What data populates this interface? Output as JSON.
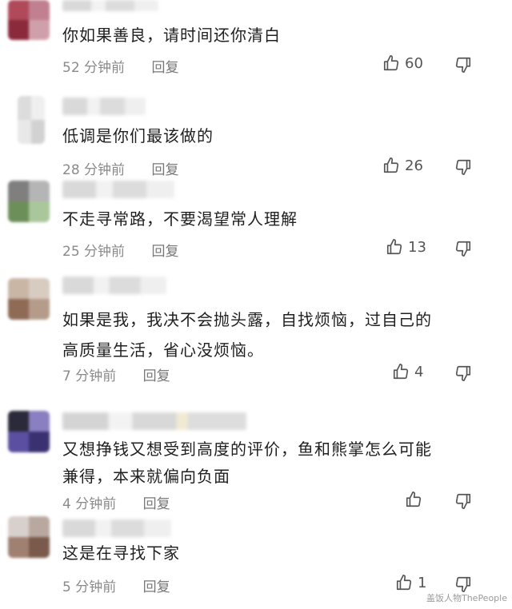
{
  "comments": [
    {
      "text": "你如果善良，请时间还你清白",
      "time": "52 分钟前",
      "reply": "回复",
      "likes": "60"
    },
    {
      "text": "低调是你们最该做的",
      "time": "28 分钟前",
      "reply": "回复",
      "likes": "26"
    },
    {
      "text": "不走寻常路，不要渴望常人理解",
      "time": "25 分钟前",
      "reply": "回复",
      "likes": "13"
    },
    {
      "text_line1": "如果是我，我决不会抛头露，自找烦恼，过自己的",
      "text_line2": "高质量生活，省心没烦恼。",
      "time": "7 分钟前",
      "reply": "回复",
      "likes": "4"
    },
    {
      "text_line1": "又想挣钱又想受到高度的评价，鱼和熊掌怎么可能",
      "text_line2": "兼得，本来就偏向负面",
      "time": "4 分钟前",
      "reply": "回复",
      "likes": ""
    },
    {
      "text": "这是在寻找下家",
      "time": "5 分钟前",
      "reply": "回复",
      "likes": "1"
    }
  ],
  "icons": {
    "like": "thumbs-up-icon",
    "dislike": "thumbs-down-icon"
  },
  "colors": {
    "text": "#1f1f1f",
    "meta": "#8a8a8a",
    "icon": "#555555"
  },
  "watermark": "盖饭人物ThePeople"
}
